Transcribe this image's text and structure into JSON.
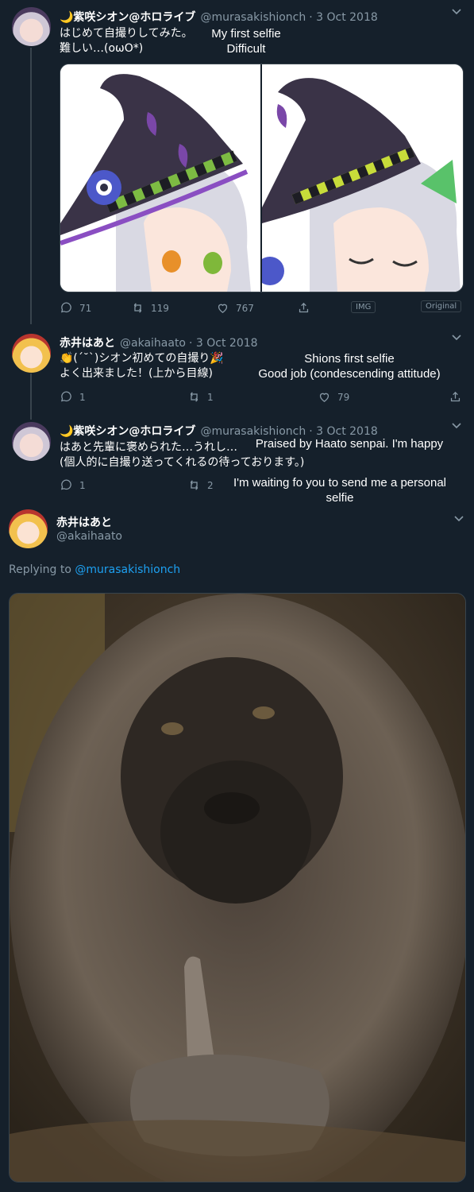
{
  "tweets": [
    {
      "name": "🌙紫咲シオン@ホロライブ",
      "handle": "@murasakishionch",
      "date": "· 3 Oct 2018",
      "line1": "はじめて自撮りしてみた。",
      "line2": "難しい…(oωO*)",
      "tl_line1": "My first selfie",
      "tl_line2": "Difficult",
      "reply_count": "71",
      "retweet_count": "119",
      "like_count": "767",
      "img_badge": "IMG",
      "original_badge": "Original"
    },
    {
      "name": "赤井はあと",
      "handle": "@akaihaato",
      "date": "· 3 Oct 2018",
      "line1": "👏(´˘`)シオン初めての自撮り🎉",
      "line2": "よく出来ました！(上から目線)",
      "tl_line1": "Shions first selfie",
      "tl_line2": "Good job (condescending attitude)",
      "reply_count": "1",
      "retweet_count": "1",
      "like_count": "79"
    },
    {
      "name": "🌙紫咲シオン@ホロライブ",
      "handle": "@murasakishionch",
      "date": "· 3 Oct 2018",
      "line1": "はあと先輩に褒められた…うれし…",
      "line2": "(個人的に自撮り送ってくれるの待っております。)",
      "tl_line1": "Praised by Haato senpai. I'm happy",
      "tl_line2": "I'm waiting fo you to send me a personal",
      "tl_line3": "selfie",
      "reply_count": "1",
      "retweet_count": "2"
    }
  ],
  "focused": {
    "name": "赤井はあと",
    "handle": "@akaihaato",
    "replying_prefix": "Replying to ",
    "replying_to": "@murasakishionch"
  },
  "colors": {
    "background": "#15202b",
    "muted": "#8899a6",
    "link": "#1da1f2",
    "border": "#38444d"
  }
}
